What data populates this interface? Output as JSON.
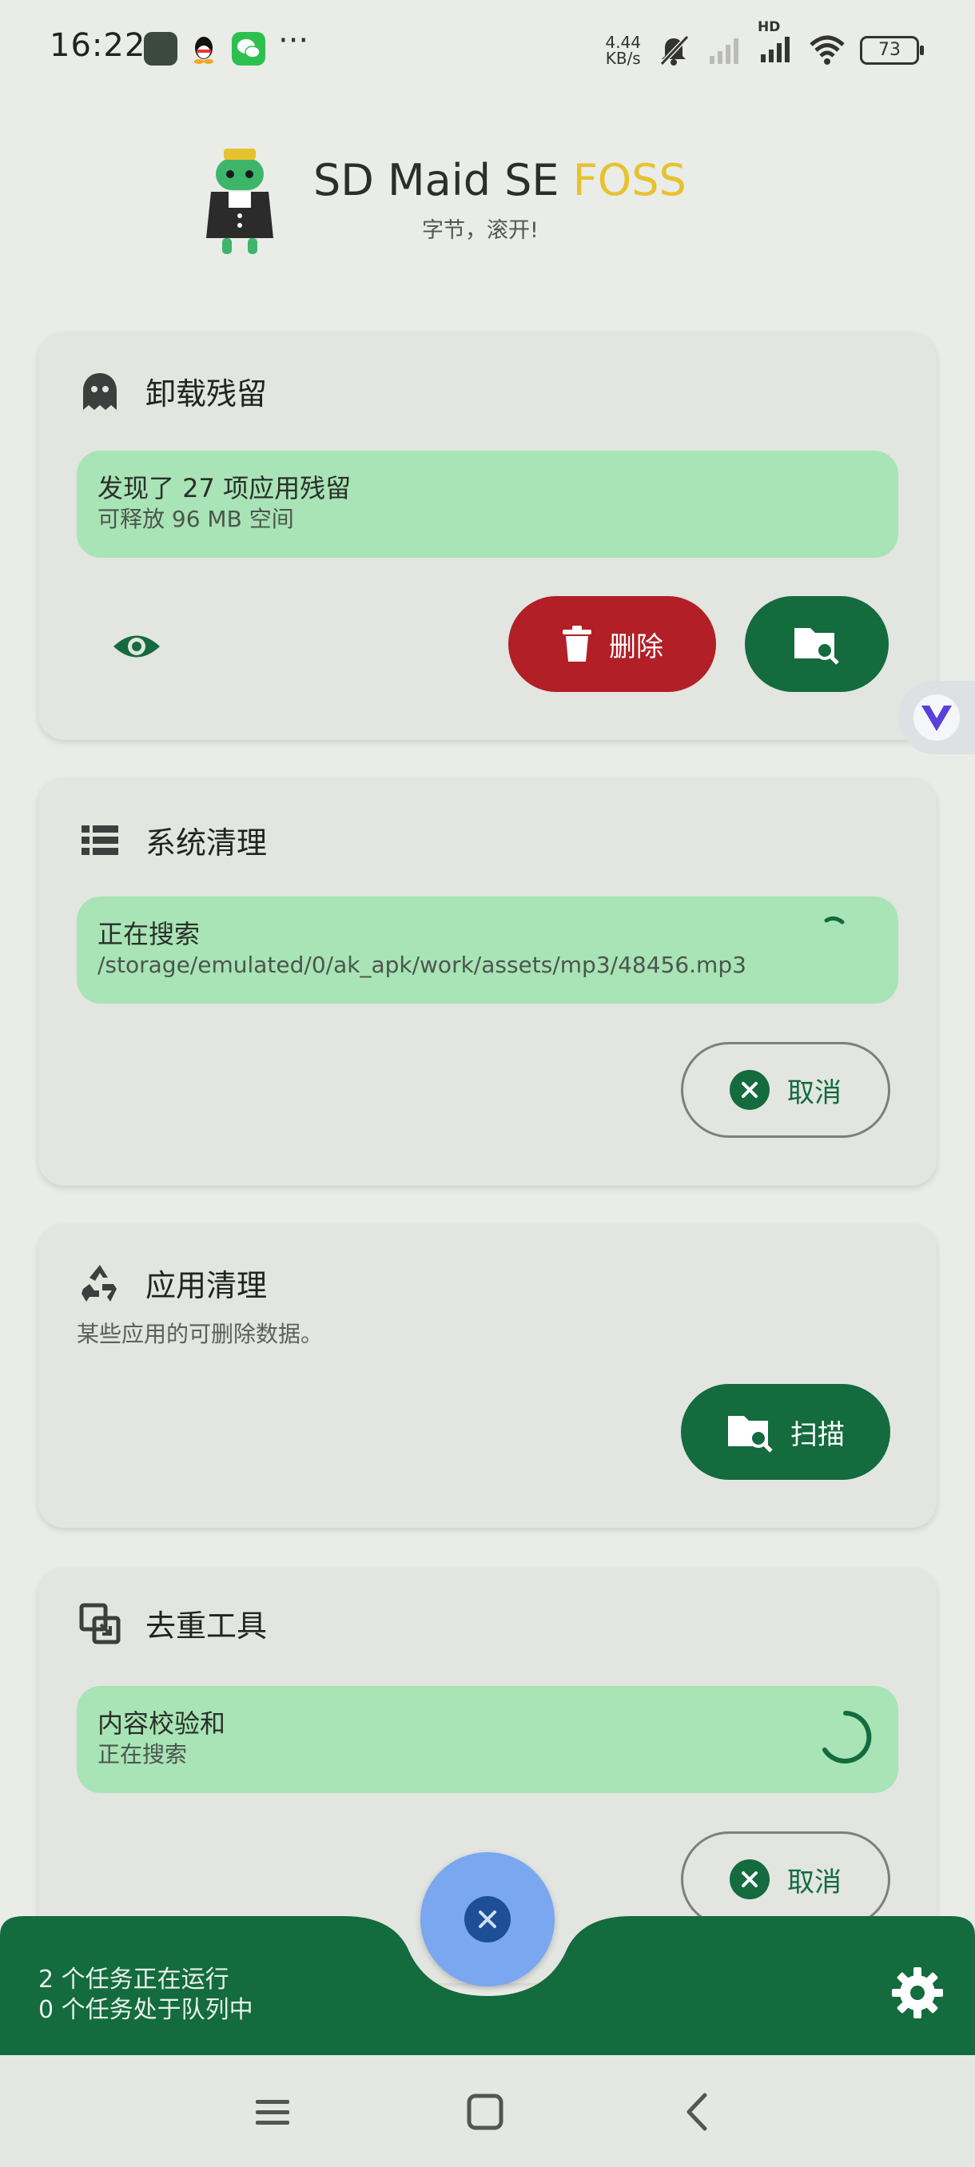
{
  "status_bar": {
    "time": "16:22",
    "more": "···",
    "speed_value": "4.44",
    "speed_unit": "KB/s",
    "signal_label": "HD",
    "battery": "73"
  },
  "header": {
    "title_main": "SD Maid SE ",
    "title_accent": "FOSS",
    "subtitle": "字节，滚开!"
  },
  "cards": {
    "corpse": {
      "title": "卸载残留",
      "info_main": "发现了 27 项应用残留",
      "info_sub": "可释放 96 MB 空间",
      "delete_label": "删除"
    },
    "system": {
      "title": "系统清理",
      "info_main": "正在搜索",
      "info_sub": "/storage/emulated/0/ak_apk/work/assets/mp3/48456.mp3",
      "cancel_label": "取消"
    },
    "app": {
      "title": "应用清理",
      "desc": "某些应用的可删除数据。",
      "scan_label": "扫描"
    },
    "dedup": {
      "title": "去重工具",
      "info_main": "内容校验和",
      "info_sub": "正在搜索",
      "cancel_label": "取消"
    }
  },
  "bottom": {
    "running": "2 个任务正在运行",
    "queued": "0 个任务处于队列中"
  },
  "colors": {
    "accent": "#136b3e",
    "info_bg": "#a8e4b5",
    "delete": "#b21f26",
    "fab": "#7aa7f0",
    "brand_yellow": "#e6c22f"
  }
}
